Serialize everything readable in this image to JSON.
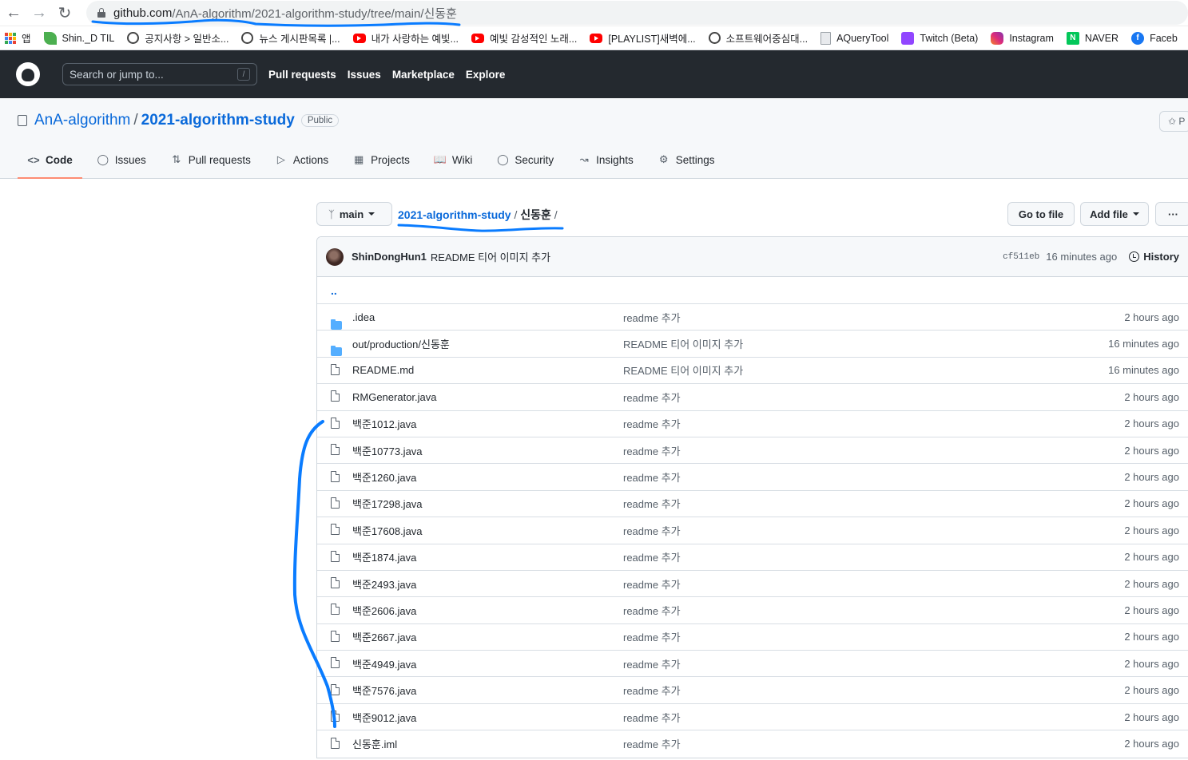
{
  "browser": {
    "url_host": "github.com",
    "url_path": "/AnA-algorithm/2021-algorithm-study/tree/main/신동훈"
  },
  "bookmarks": [
    {
      "label": "앱",
      "icon": "apps-grid-icon"
    },
    {
      "label": "Shin._D TIL",
      "icon": "leaf-icon"
    },
    {
      "label": "공지사항 > 일반소...",
      "icon": "globe-icon"
    },
    {
      "label": "뉴스 게시판목록 |...",
      "icon": "globe-icon"
    },
    {
      "label": "내가 사랑하는 예빛...",
      "icon": "youtube-icon"
    },
    {
      "label": "예빛 감성적인 노래...",
      "icon": "youtube-icon"
    },
    {
      "label": "[PLAYLIST]새벽에...",
      "icon": "youtube-icon"
    },
    {
      "label": "소프트웨어중심대...",
      "icon": "globe-icon"
    },
    {
      "label": "AQueryTool",
      "icon": "document-icon"
    },
    {
      "label": "Twitch (Beta)",
      "icon": "twitch-icon"
    },
    {
      "label": "Instagram",
      "icon": "instagram-icon"
    },
    {
      "label": "NAVER",
      "icon": "naver-icon"
    },
    {
      "label": "Faceb",
      "icon": "facebook-icon"
    }
  ],
  "gh_header": {
    "search_placeholder": "Search or jump to...",
    "slash_key": "/",
    "nav": [
      "Pull requests",
      "Issues",
      "Marketplace",
      "Explore"
    ]
  },
  "repo": {
    "owner": "AnA-algorithm",
    "separator": "/",
    "name": "2021-algorithm-study",
    "visibility": "Public",
    "pin_label": "P"
  },
  "tabs": [
    {
      "label": "Code",
      "icon": "code-icon",
      "active": true
    },
    {
      "label": "Issues",
      "icon": "issue-icon",
      "active": false
    },
    {
      "label": "Pull requests",
      "icon": "pull-request-icon",
      "active": false
    },
    {
      "label": "Actions",
      "icon": "play-icon",
      "active": false
    },
    {
      "label": "Projects",
      "icon": "table-icon",
      "active": false
    },
    {
      "label": "Wiki",
      "icon": "book-icon",
      "active": false
    },
    {
      "label": "Security",
      "icon": "shield-icon",
      "active": false
    },
    {
      "label": "Insights",
      "icon": "graph-icon",
      "active": false
    },
    {
      "label": "Settings",
      "icon": "gear-icon",
      "active": false
    }
  ],
  "file_nav": {
    "branch": "main",
    "breadcrumb_repo": "2021-algorithm-study",
    "breadcrumb_sep": "/",
    "breadcrumb_dir": "신동훈",
    "breadcrumb_trail": "/",
    "go_to_file": "Go to file",
    "add_file": "Add file",
    "more": "···"
  },
  "commit": {
    "author": "ShinDongHun1",
    "message": "README 티어 이미지 추가",
    "sha": "cf511eb",
    "time": "16 minutes ago",
    "history": "History"
  },
  "up_dir": "..",
  "files": [
    {
      "name": ".idea",
      "type": "dir",
      "message": "readme 추가",
      "age": "2 hours ago"
    },
    {
      "name": "out/production/신동훈",
      "type": "dir",
      "message": "README 티어 이미지 추가",
      "age": "16 minutes ago"
    },
    {
      "name": "README.md",
      "type": "file",
      "message": "README 티어 이미지 추가",
      "age": "16 minutes ago"
    },
    {
      "name": "RMGenerator.java",
      "type": "file",
      "message": "readme 추가",
      "age": "2 hours ago"
    },
    {
      "name": "백준1012.java",
      "type": "file",
      "message": "readme 추가",
      "age": "2 hours ago"
    },
    {
      "name": "백준10773.java",
      "type": "file",
      "message": "readme 추가",
      "age": "2 hours ago"
    },
    {
      "name": "백준1260.java",
      "type": "file",
      "message": "readme 추가",
      "age": "2 hours ago"
    },
    {
      "name": "백준17298.java",
      "type": "file",
      "message": "readme 추가",
      "age": "2 hours ago"
    },
    {
      "name": "백준17608.java",
      "type": "file",
      "message": "readme 추가",
      "age": "2 hours ago"
    },
    {
      "name": "백준1874.java",
      "type": "file",
      "message": "readme 추가",
      "age": "2 hours ago"
    },
    {
      "name": "백준2493.java",
      "type": "file",
      "message": "readme 추가",
      "age": "2 hours ago"
    },
    {
      "name": "백준2606.java",
      "type": "file",
      "message": "readme 추가",
      "age": "2 hours ago"
    },
    {
      "name": "백준2667.java",
      "type": "file",
      "message": "readme 추가",
      "age": "2 hours ago"
    },
    {
      "name": "백준4949.java",
      "type": "file",
      "message": "readme 추가",
      "age": "2 hours ago"
    },
    {
      "name": "백준7576.java",
      "type": "file",
      "message": "readme 추가",
      "age": "2 hours ago"
    },
    {
      "name": "백준9012.java",
      "type": "file",
      "message": "readme 추가",
      "age": "2 hours ago"
    },
    {
      "name": "신동훈.iml",
      "type": "file",
      "message": "readme 추가",
      "age": "2 hours ago"
    }
  ],
  "colors": {
    "annotation": "#0a7cff",
    "link": "#0969da",
    "header_bg": "#24292f",
    "active_tab": "#fd8c73"
  }
}
